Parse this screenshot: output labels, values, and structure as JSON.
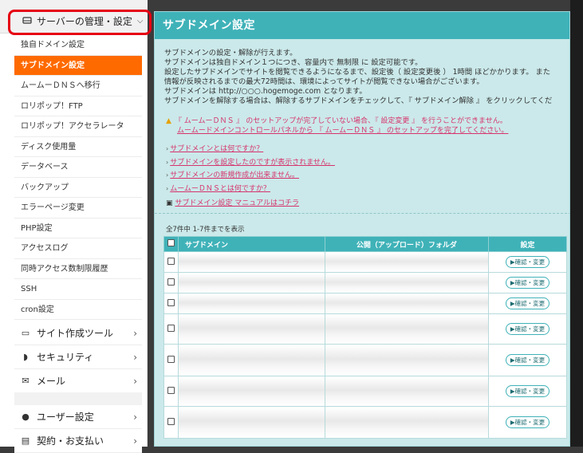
{
  "sidebar": {
    "server_head": "サーバーの管理・設定",
    "sub_items": [
      {
        "label": "独自ドメイン設定",
        "active": false
      },
      {
        "label": "サブドメイン設定",
        "active": true
      },
      {
        "label": "ムームーＤＮＳへ移行",
        "active": false
      },
      {
        "label": "ロリポップ！FTP",
        "active": false
      },
      {
        "label": "ロリポップ！アクセラレータ",
        "active": false
      },
      {
        "label": "ディスク使用量",
        "active": false
      },
      {
        "label": "データベース",
        "active": false
      },
      {
        "label": "バックアップ",
        "active": false
      },
      {
        "label": "エラーページ変更",
        "active": false
      },
      {
        "label": "PHP設定",
        "active": false
      },
      {
        "label": "アクセスログ",
        "active": false
      },
      {
        "label": "同時アクセス数制限履歴",
        "active": false
      },
      {
        "label": "SSH",
        "active": false
      },
      {
        "label": "cron設定",
        "active": false
      }
    ],
    "groups": [
      {
        "label": "サイト作成ツール",
        "icon": "laptop-icon"
      },
      {
        "label": "セキュリティ",
        "icon": "shield-icon"
      },
      {
        "label": "メール",
        "icon": "mail-icon"
      },
      {
        "label": "ユーザー設定",
        "icon": "user-icon"
      },
      {
        "label": "契約・お支払い",
        "icon": "card-icon"
      }
    ]
  },
  "main": {
    "title": "サブドメイン設定",
    "intro": [
      "サブドメインの設定・解除が行えます。",
      "サブドメインは独自ドメイン１つにつき、容量内で 無制限 に 設定可能です。",
      "設定したサブドメインでサイトを閲覧できるようになるまで、設定後（ 設定変更後 ） 1時間 ほどかかります。 また",
      "情報が反映されるまでの最大72時間は、環境によってサイトが閲覧できない場合がございます。",
      "サブドメインは http://○○○.hogemoge.com となります。",
      "サブドメインを解除する場合は、解除するサブドメインをチェックして、『 サブドメイン解除 』 をクリックしてくだ"
    ],
    "warning": [
      "『 ムームーＤＮＳ 』 のセットアップが完了していない場合、『 設定変更 』 を行うことができません。",
      "ムームードメインコントロールパネルから 『 ムームーＤＮＳ 』 のセットアップを完了してください。"
    ],
    "links": [
      "サブドメインとは何ですか？",
      "サブドメインを設定したのですが表示されません。",
      "サブドメインの新規作成が出来ません。",
      "ムームーＤＮＳとは何ですか？"
    ],
    "manual_link": "サブドメイン設定 マニュアルはコチラ",
    "count_text": "全7件中 1-7件までを表示",
    "table": {
      "headers": [
        "サブドメイン",
        "公開（アップロード）フォルダ",
        "設定"
      ],
      "button_label": "▶確認・変更",
      "row_count": 7
    }
  }
}
